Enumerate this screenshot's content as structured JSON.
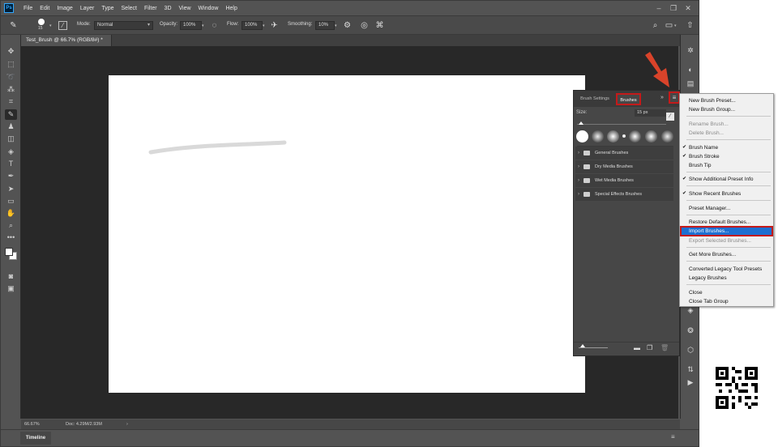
{
  "app": {
    "logo": "Ps",
    "menu": [
      "File",
      "Edit",
      "Image",
      "Layer",
      "Type",
      "Select",
      "Filter",
      "3D",
      "View",
      "Window",
      "Help"
    ]
  },
  "options": {
    "brush_size": "15",
    "mode_label": "Mode:",
    "mode_value": "Normal",
    "opacity_label": "Opacity:",
    "opacity_value": "100%",
    "flow_label": "Flow:",
    "flow_value": "100%",
    "smoothing_label": "Smoothing:",
    "smoothing_value": "10%"
  },
  "document": {
    "tab_title": "Test_Brush @ 66.7% (RGB/8#) *",
    "stroke_color": "#d9d9d9"
  },
  "status": {
    "zoom": "66.67%",
    "doc_info": "Doc: 4.29M/2.93M",
    "arrow": "›"
  },
  "timeline": {
    "label": "Timeline"
  },
  "brush_panel": {
    "tab_settings": "Brush Settings",
    "tab_brushes": "Brushes",
    "size_label": "Size:",
    "size_value": "15 px",
    "folders": [
      "General Brushes",
      "Dry Media Brushes",
      "Wet Media Brushes",
      "Special Effects Brushes"
    ]
  },
  "flyout_menu": {
    "new_brush_preset": "New Brush Preset...",
    "new_brush_group": "New Brush Group...",
    "rename_brush": "Rename Brush...",
    "delete_brush": "Delete Brush...",
    "brush_name": "Brush Name",
    "brush_stroke": "Brush Stroke",
    "brush_tip": "Brush Tip",
    "show_additional_preset_info": "Show Additional Preset Info",
    "show_recent_brushes": "Show Recent Brushes",
    "preset_manager": "Preset Manager...",
    "restore_default_brushes": "Restore Default Brushes...",
    "import_brushes": "Import Brushes...",
    "export_selected_brushes": "Export Selected Brushes...",
    "get_more_brushes": "Get More Brushes...",
    "converted_legacy_tool_presets": "Converted Legacy Tool Presets",
    "legacy_brushes": "Legacy Brushes",
    "close": "Close",
    "close_tab_group": "Close Tab Group",
    "checked": [
      "Brush Name",
      "Brush Stroke",
      "Show Additional Preset Info",
      "Show Recent Brushes"
    ],
    "highlighted": "Import Brushes..."
  },
  "colors": {
    "highlight_box": "#c41a1a",
    "arrow": "#d9432a",
    "selection": "#1e6fd1"
  }
}
